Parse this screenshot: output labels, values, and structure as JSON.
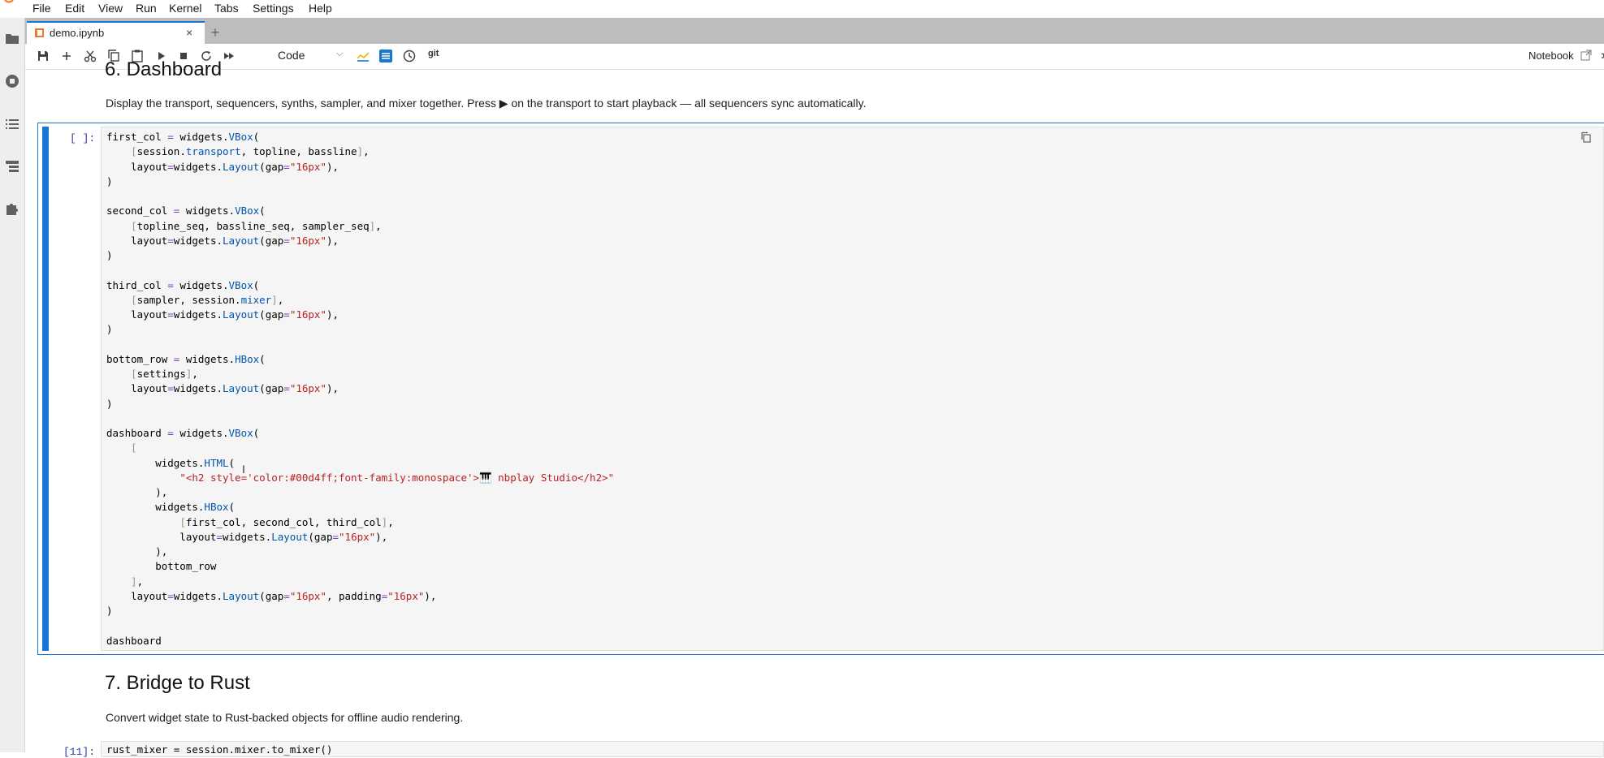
{
  "menu": [
    "File",
    "Edit",
    "View",
    "Run",
    "Kernel",
    "Tabs",
    "Settings",
    "Help"
  ],
  "tab": {
    "title": "demo.ipynb",
    "close": "×",
    "add": "+"
  },
  "toolbar": {
    "cell_type": "Code",
    "git_label": "git",
    "notebook_label": "Notebook",
    "icons": [
      "save-icon",
      "add-cell-icon",
      "cut-icon",
      "copy-icon",
      "paste-icon",
      "run-icon",
      "stop-icon",
      "restart-icon",
      "fast-forward-icon",
      "chart-icon",
      "table-icon",
      "clock-icon"
    ]
  },
  "sidebar": {
    "icons": [
      "folder-icon",
      "running-icon",
      "toc-icon",
      "property-inspector-icon",
      "extensions-icon"
    ]
  },
  "notebook": {
    "section6_heading": "6. Dashboard",
    "section6_text": "Display the transport, sequencers, synths, sampler, and mixer together. Press ▶ on the transport to start playback — all sequencers sync automatically.",
    "cell_prompt": "[ ]:",
    "section7_heading": "7. Bridge to Rust",
    "section7_text": "Convert widget state to Rust-backed objects for offline audio rendering.",
    "cell2_prompt": "[11]:",
    "cell2_code": "rust_mixer = session.mixer.to_mixer()"
  },
  "colors": {
    "accent": "#1976d2",
    "string": "#ba2121",
    "attribute": "#0055aa",
    "operator": "#7f3fbf",
    "cell_bg": "#f5f5f5",
    "tabbar_bg": "#bdbdbd"
  }
}
